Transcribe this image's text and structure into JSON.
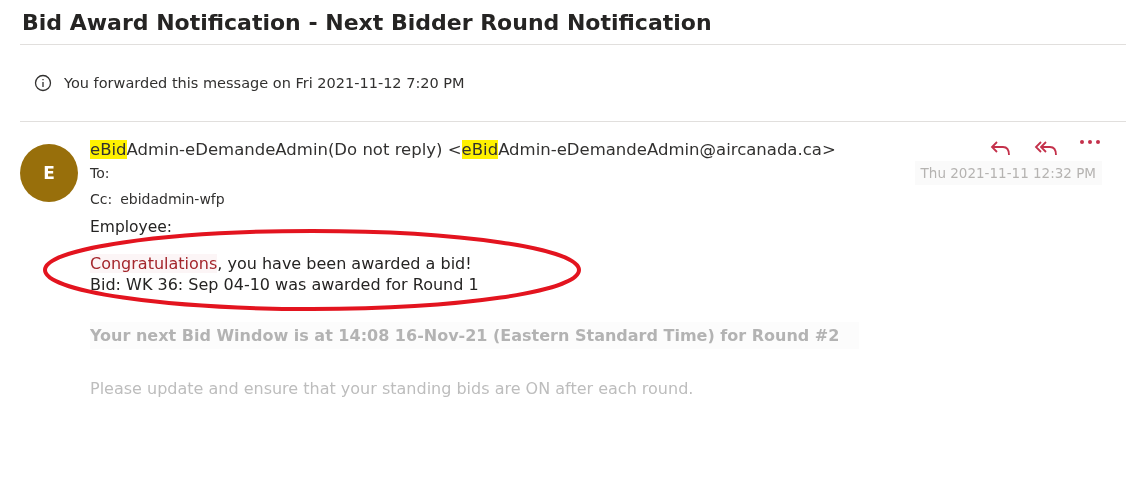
{
  "subject": "Bid Award Notification - Next Bidder Round Notification",
  "info_bar": {
    "text": "You forwarded this message on Fri 2021-11-12 7:20 PM"
  },
  "message": {
    "avatar": "E",
    "sender": [
      {
        "text": "eBid",
        "highlighted": true
      },
      {
        "text": "Admin-eDemandeAdmin(Do not reply) <",
        "highlighted": false
      },
      {
        "text": "eBid",
        "highlighted": true
      },
      {
        "text": "Admin-eDemandeAdmin@aircanada.ca>",
        "highlighted": false
      }
    ],
    "actions": [
      {
        "kind": "reply"
      },
      {
        "kind": "reply_all"
      },
      {
        "kind": "more"
      }
    ],
    "to_label": "To:",
    "cc_label": "Cc:",
    "cc_value": "ebidadmin-wfp",
    "timestamp": "Thu 2021-11-11 12:32 PM",
    "body": {
      "greeting": "Employee:",
      "award": {
        "circled": true,
        "lines": [
          [
            {
              "text": "Congratulations",
              "emphasis": true
            },
            {
              "text": ", you have been awarded a bid!",
              "emphasis": false
            }
          ],
          [
            {
              "text": "Bid: WK 36: Sep 04-10 was awarded for Round 1",
              "emphasis": false
            }
          ]
        ]
      },
      "next_window": "Your next Bid Window is at 14:08 16-Nov-21 (Eastern Standard Time) for Round #2",
      "reminder": "Please update and ensure that your standing bids are ON after each round."
    }
  }
}
